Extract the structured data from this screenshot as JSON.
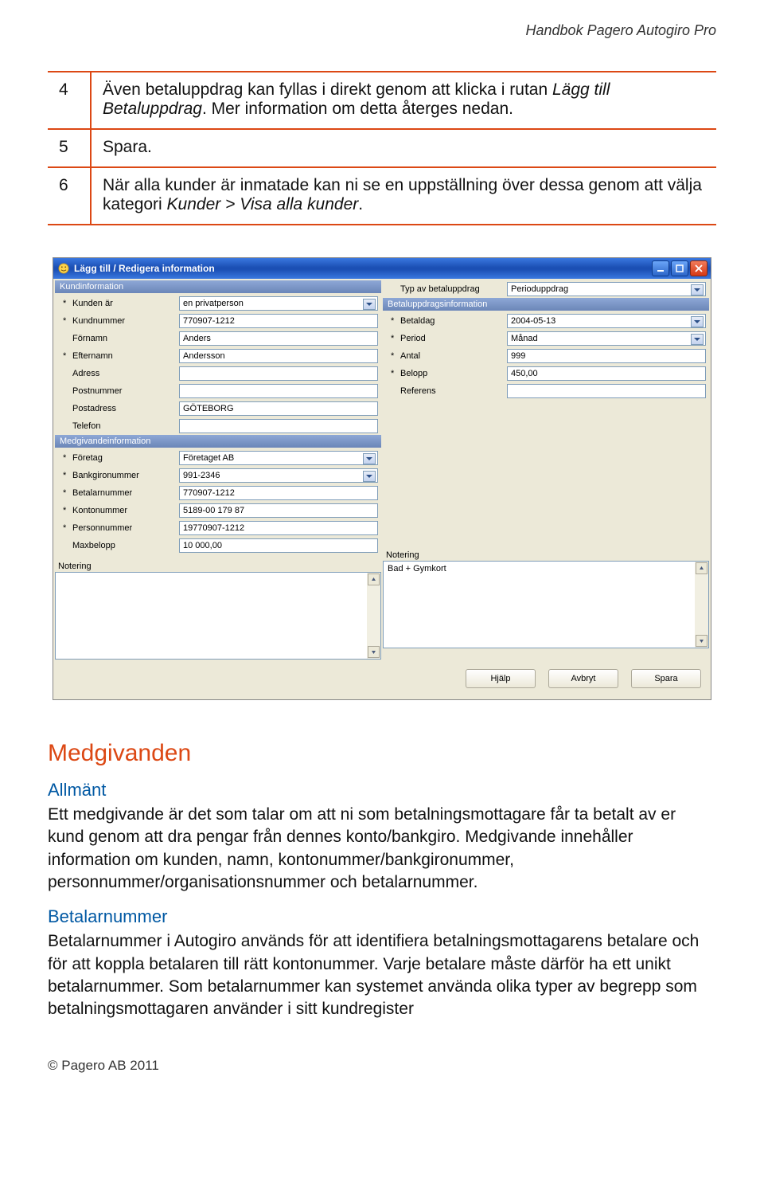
{
  "header": {
    "title": "Handbok Pagero Autogiro Pro"
  },
  "steps": [
    {
      "num": "4",
      "text": "Även betaluppdrag kan fyllas i direkt genom att klicka i rutan ",
      "em": "Lägg till Betaluppdrag",
      "after": ". Mer information om detta återges nedan."
    },
    {
      "num": "5",
      "text": "Spara."
    },
    {
      "num": "6",
      "text": "När alla kunder är inmatade kan ni se en uppställning över dessa genom att välja kategori ",
      "em": "Kunder > Visa alla kunder",
      "after": "."
    }
  ],
  "dialog": {
    "title": "Lägg till / Redigera information",
    "left": {
      "section1": {
        "head": "Kundinformation",
        "rows": [
          {
            "star": "*",
            "label": "Kunden är",
            "value": "en privatperson",
            "combo": true
          },
          {
            "star": "*",
            "label": "Kundnummer",
            "value": "770907-1212"
          },
          {
            "star": "",
            "label": "Förnamn",
            "value": "Anders"
          },
          {
            "star": "*",
            "label": "Efternamn",
            "value": "Andersson"
          },
          {
            "star": "",
            "label": "Adress",
            "value": ""
          },
          {
            "star": "",
            "label": "Postnummer",
            "value": ""
          },
          {
            "star": "",
            "label": "Postadress",
            "value": "GÖTEBORG"
          },
          {
            "star": "",
            "label": "Telefon",
            "value": ""
          }
        ]
      },
      "section2": {
        "head": "Medgivandeinformation",
        "rows": [
          {
            "star": "*",
            "label": "Företag",
            "value": "Företaget AB",
            "combo": true
          },
          {
            "star": "*",
            "label": "Bankgironummer",
            "value": "991-2346",
            "combo": true
          },
          {
            "star": "*",
            "label": "Betalarnummer",
            "value": "770907-1212"
          },
          {
            "star": "*",
            "label": "Kontonummer",
            "value": "5189-00 179 87"
          },
          {
            "star": "*",
            "label": "Personnummer",
            "value": "19770907-1212"
          },
          {
            "star": "",
            "label": "Maxbelopp",
            "value": "10 000,00"
          }
        ]
      },
      "notering_label": "Notering",
      "notering_text": ""
    },
    "right": {
      "top_row": {
        "label": "Typ av betaluppdrag",
        "value": "Perioduppdrag",
        "combo": true
      },
      "section1": {
        "head": "Betaluppdragsinformation",
        "rows": [
          {
            "star": "*",
            "label": "Betaldag",
            "value": "2004-05-13",
            "combo": true
          },
          {
            "star": "*",
            "label": "Period",
            "value": "Månad",
            "combo": true
          },
          {
            "star": "*",
            "label": "Antal",
            "value": "999"
          },
          {
            "star": "*",
            "label": "Belopp",
            "value": "450,00"
          },
          {
            "star": "",
            "label": "Referens",
            "value": ""
          }
        ]
      },
      "notering_label": "Notering",
      "notering_text": "Bad + Gymkort"
    },
    "buttons": {
      "help": "Hjälp",
      "cancel": "Avbryt",
      "save": "Spara"
    }
  },
  "content": {
    "h2": "Medgivanden",
    "h3a": "Allmänt",
    "p1": "Ett medgivande är det som talar om att ni som betalningsmottagare får ta betalt av er kund genom att dra pengar från dennes konto/bankgiro. Medgivande innehåller information om kunden, namn, kontonummer/bankgironummer, personnummer/organisationsnummer och betalarnummer.",
    "h3b": "Betalarnummer",
    "p2": "Betalarnummer i Autogiro används för att identifiera betalningsmottagarens betalare och för att koppla betalaren till rätt kontonummer. Varje betalare måste därför ha ett unikt betalarnummer. Som betalarnummer kan systemet använda olika typer av begrepp som betalningsmottagaren använder i sitt kundregister"
  },
  "footer": "© Pagero AB 2011"
}
